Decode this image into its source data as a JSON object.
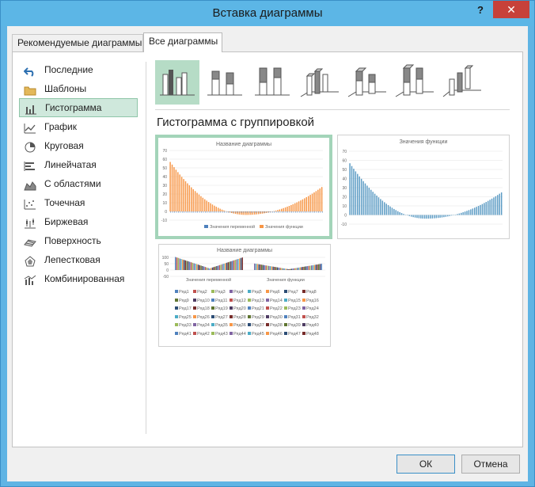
{
  "window": {
    "title": "Вставка диаграммы",
    "help_label": "?",
    "close_label": "✕"
  },
  "tabs": [
    {
      "label": "Рекомендуемые диаграммы"
    },
    {
      "label": "Все диаграммы"
    }
  ],
  "active_tab": 1,
  "sidebar": {
    "items": [
      {
        "label": "Последние",
        "icon": "undo-icon"
      },
      {
        "label": "Шаблоны",
        "icon": "folder-icon"
      },
      {
        "label": "Гистограмма",
        "icon": "column-chart-icon"
      },
      {
        "label": "График",
        "icon": "line-chart-icon"
      },
      {
        "label": "Круговая",
        "icon": "pie-chart-icon"
      },
      {
        "label": "Линейчатая",
        "icon": "bar-chart-icon"
      },
      {
        "label": "С областями",
        "icon": "area-chart-icon"
      },
      {
        "label": "Точечная",
        "icon": "scatter-chart-icon"
      },
      {
        "label": "Биржевая",
        "icon": "stock-chart-icon"
      },
      {
        "label": "Поверхность",
        "icon": "surface-chart-icon"
      },
      {
        "label": "Лепестковая",
        "icon": "radar-chart-icon"
      },
      {
        "label": "Комбинированная",
        "icon": "combo-chart-icon"
      }
    ],
    "active_index": 2
  },
  "chart_types": [
    {
      "name": "clustered-column-icon"
    },
    {
      "name": "stacked-column-icon"
    },
    {
      "name": "100-stacked-column-icon"
    },
    {
      "name": "3d-clustered-column-icon"
    },
    {
      "name": "3d-stacked-column-icon"
    },
    {
      "name": "3d-100-stacked-column-icon"
    },
    {
      "name": "3d-column-icon"
    }
  ],
  "selected_chart_type": 0,
  "subtype_title": "Гистограмма с группировкой",
  "previews": {
    "preview1": {
      "title": "Название диаграммы",
      "y_ticks": [
        "70",
        "60",
        "50",
        "40",
        "30",
        "20",
        "10",
        "0",
        "-10"
      ],
      "legend": [
        "Значения переменной",
        "Значения функции"
      ]
    },
    "preview2": {
      "title": "Значения функции",
      "y_ticks": [
        "70",
        "60",
        "50",
        "40",
        "30",
        "20",
        "10",
        "0",
        "-10"
      ]
    },
    "preview3": {
      "title": "Название диаграммы",
      "y_ticks": [
        "100",
        "50",
        "0",
        "-50"
      ],
      "x_labels": [
        "Значения переменной",
        "Значения функции"
      ],
      "legend_rows": [
        [
          "Ряд1",
          "Ряд2",
          "Ряд3",
          "Ряд4",
          "Ряд5",
          "Ряд6",
          "Ряд7",
          "Ряд8"
        ],
        [
          "Ряд9",
          "Ряд10",
          "Ряд11",
          "Ряд12",
          "Ряд13",
          "Ряд14",
          "Ряд15",
          "Ряд16"
        ],
        [
          "Ряд17",
          "Ряд18",
          "Ряд19",
          "Ряд20",
          "Ряд21",
          "Ряд22",
          "Ряд23",
          "Ряд24"
        ],
        [
          "Ряд25",
          "Ряд26",
          "Ряд27",
          "Ряд28",
          "Ряд29",
          "Ряд30",
          "Ряд31",
          "Ряд32"
        ],
        [
          "Ряд33",
          "Ряд34",
          "Ряд35",
          "Ряд36",
          "Ряд37",
          "Ряд38",
          "Ряд39",
          "Ряд40"
        ],
        [
          "Ряд41",
          "Ряд42",
          "Ряд43",
          "Ряд44",
          "Ряд45",
          "Ряд46",
          "Ряд47",
          "Ряд48"
        ]
      ]
    }
  },
  "colors": {
    "accent_green": "#b6dcc6",
    "series_blue": "#4f81bd",
    "series_orange": "#f79646",
    "series_steel": "#5b9bc4"
  },
  "buttons": {
    "ok": "ОК",
    "cancel": "Отмена"
  }
}
